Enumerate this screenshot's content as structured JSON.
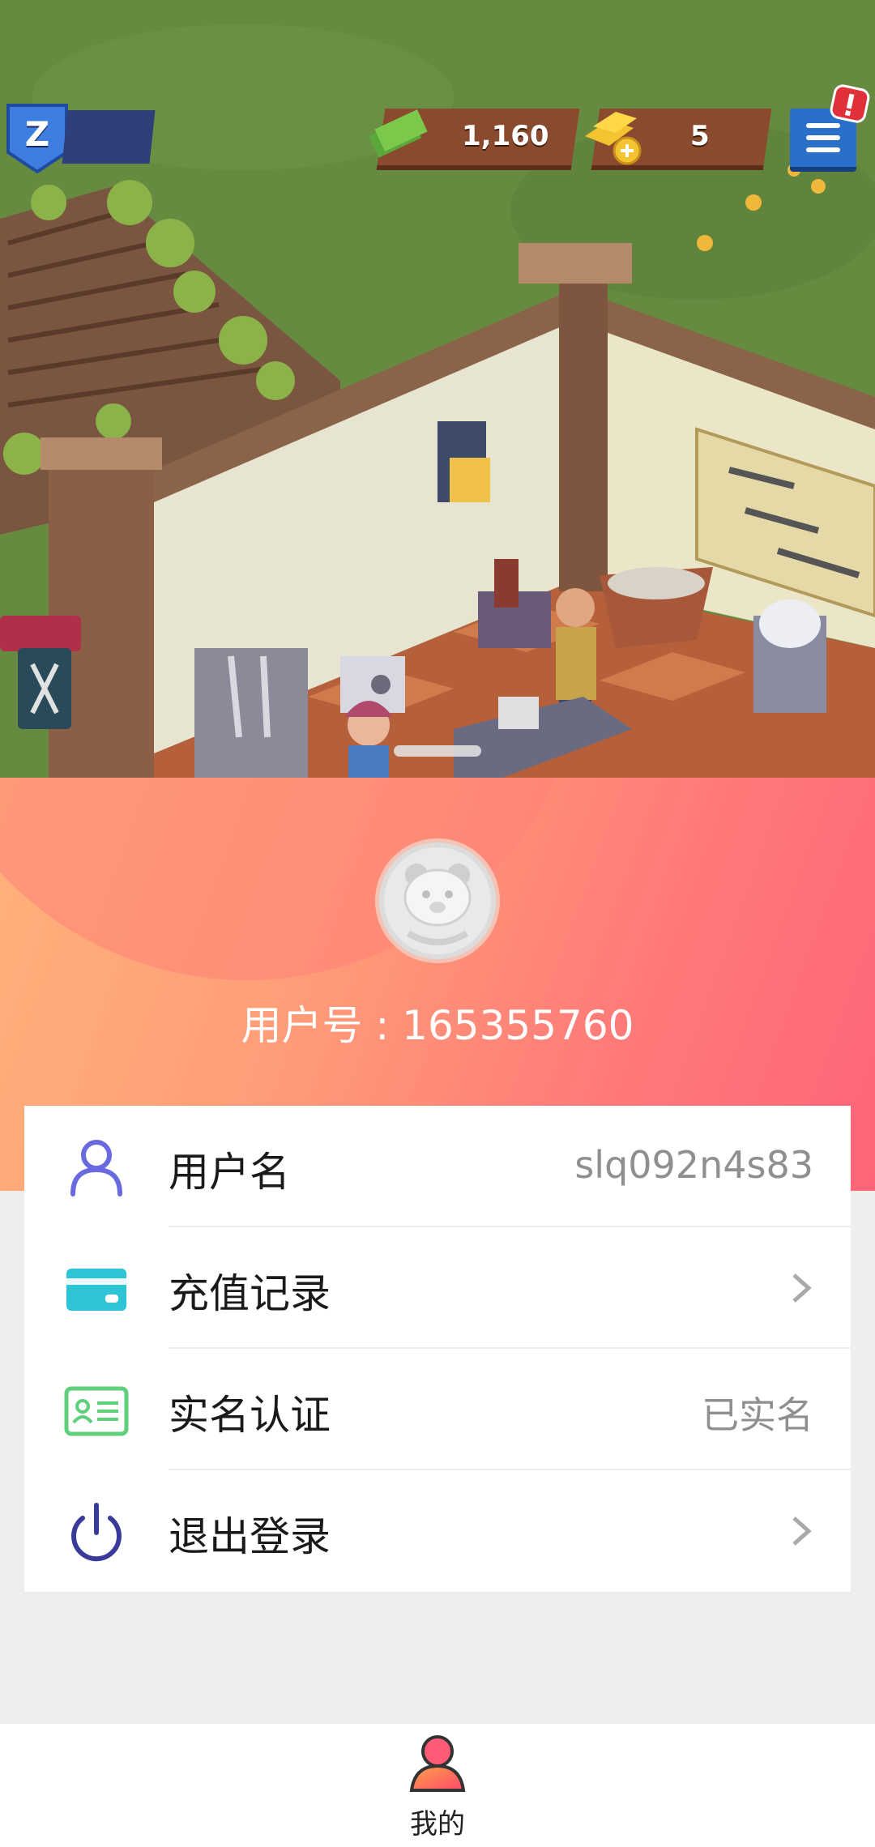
{
  "game": {
    "level": "Z",
    "cash": "1,160",
    "gold": "5",
    "shop_sign": "weapon"
  },
  "profile": {
    "user_id_text": "用户号 : 165355760"
  },
  "menu": {
    "items": [
      {
        "label": "用户名",
        "value": "slq092n4s83",
        "icon": "user-icon"
      },
      {
        "label": "充值记录",
        "value": "",
        "icon": "card-icon"
      },
      {
        "label": "实名认证",
        "value": "已实名",
        "icon": "id-card-icon"
      },
      {
        "label": "退出登录",
        "value": "",
        "icon": "power-icon"
      }
    ]
  },
  "nav": {
    "items": [
      {
        "label": "我的",
        "icon": "person-icon",
        "active": true
      }
    ]
  },
  "colors": {
    "header_gradient_start": "#ffb27a",
    "header_gradient_end": "#ff6478",
    "user_icon": "#6a6ae0",
    "card_icon": "#2ec4d6",
    "id_icon": "#5fd07a",
    "power_icon": "#3a3a9a"
  }
}
